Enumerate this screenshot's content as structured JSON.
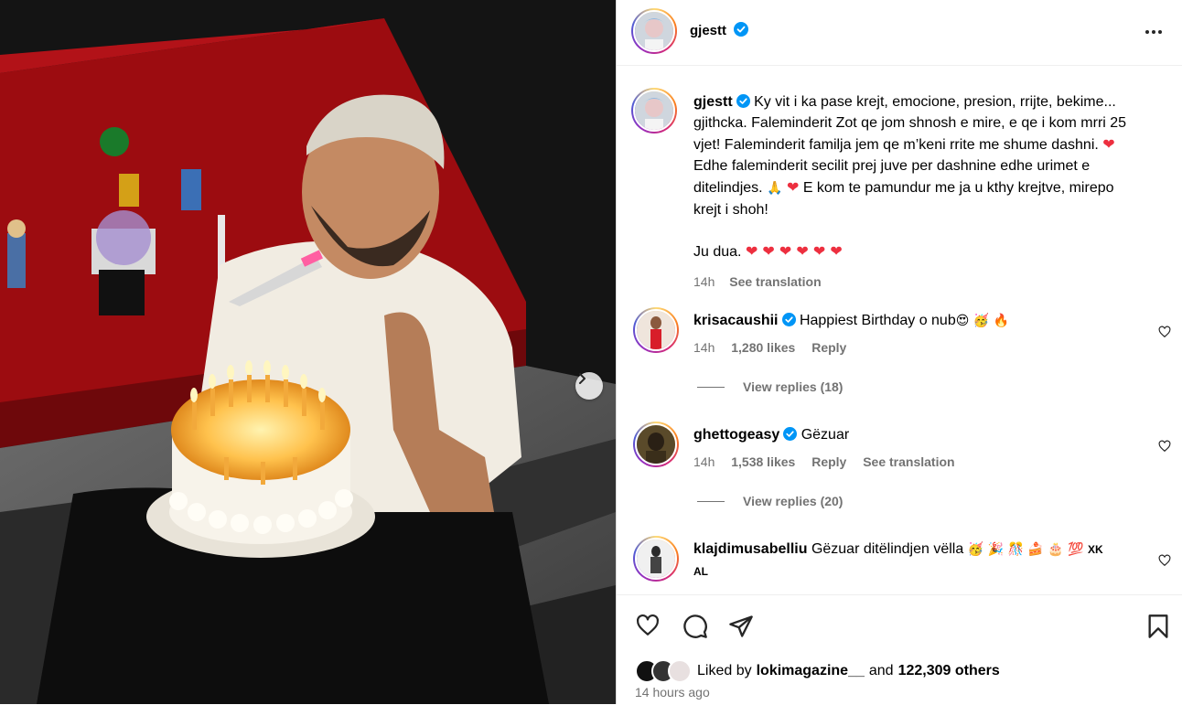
{
  "post": {
    "username": "gjestt",
    "caption_lines": [
      "Ky vit i ka pase krejt, emocione, presion, rrijte, bekime...",
      "gjithcka. Faleminderit Zot qe jom shnosh e mire, e qe i kom mrri 25",
      "vjet! Faleminderit familja jem qe m’keni rrite me shume dashni.",
      "Edhe faleminderit secilit prej juve per dashnine edhe urimet e",
      "ditelindjes.",
      "E kom te pamundur me ja u kthy krejtve, mirepo",
      "krejt i shoh!"
    ],
    "caption_closing": "Ju dua.",
    "caption_time": "14h",
    "see_translation": "See translation",
    "liked_by_prefix": "Liked by",
    "liked_by_user": "lokimagazine__",
    "liked_by_and": "and",
    "liked_by_others": "122,309 others",
    "time_ago": "14 hours ago"
  },
  "comments": [
    {
      "username": "krisacaushii",
      "text": "Happiest Birthday o nub",
      "time": "14h",
      "likes": "1,280 likes",
      "reply": "Reply",
      "view_replies": "View replies (18)"
    },
    {
      "username": "ghettogeasy",
      "text": "Gëzuar",
      "time": "14h",
      "likes": "1,538 likes",
      "reply": "Reply",
      "translate": "See translation",
      "view_replies": "View replies (20)"
    },
    {
      "username": "klajdimusabelliu",
      "text": "Gëzuar ditëlindjen vëlla",
      "suffix": "XK",
      "line2": "AL"
    }
  ],
  "icons": {
    "verified": "verified-badge-icon",
    "more": "more-horizontal-icon",
    "like": "heart-icon",
    "comment": "comment-bubble-icon",
    "share": "paper-plane-icon",
    "save": "bookmark-icon",
    "next": "chevron-right-icon"
  },
  "colors": {
    "accent_blue": "#0095f6",
    "verified_blue": "#0095f6",
    "text_secondary": "#737373",
    "heart_red": "#ed2f3f"
  }
}
